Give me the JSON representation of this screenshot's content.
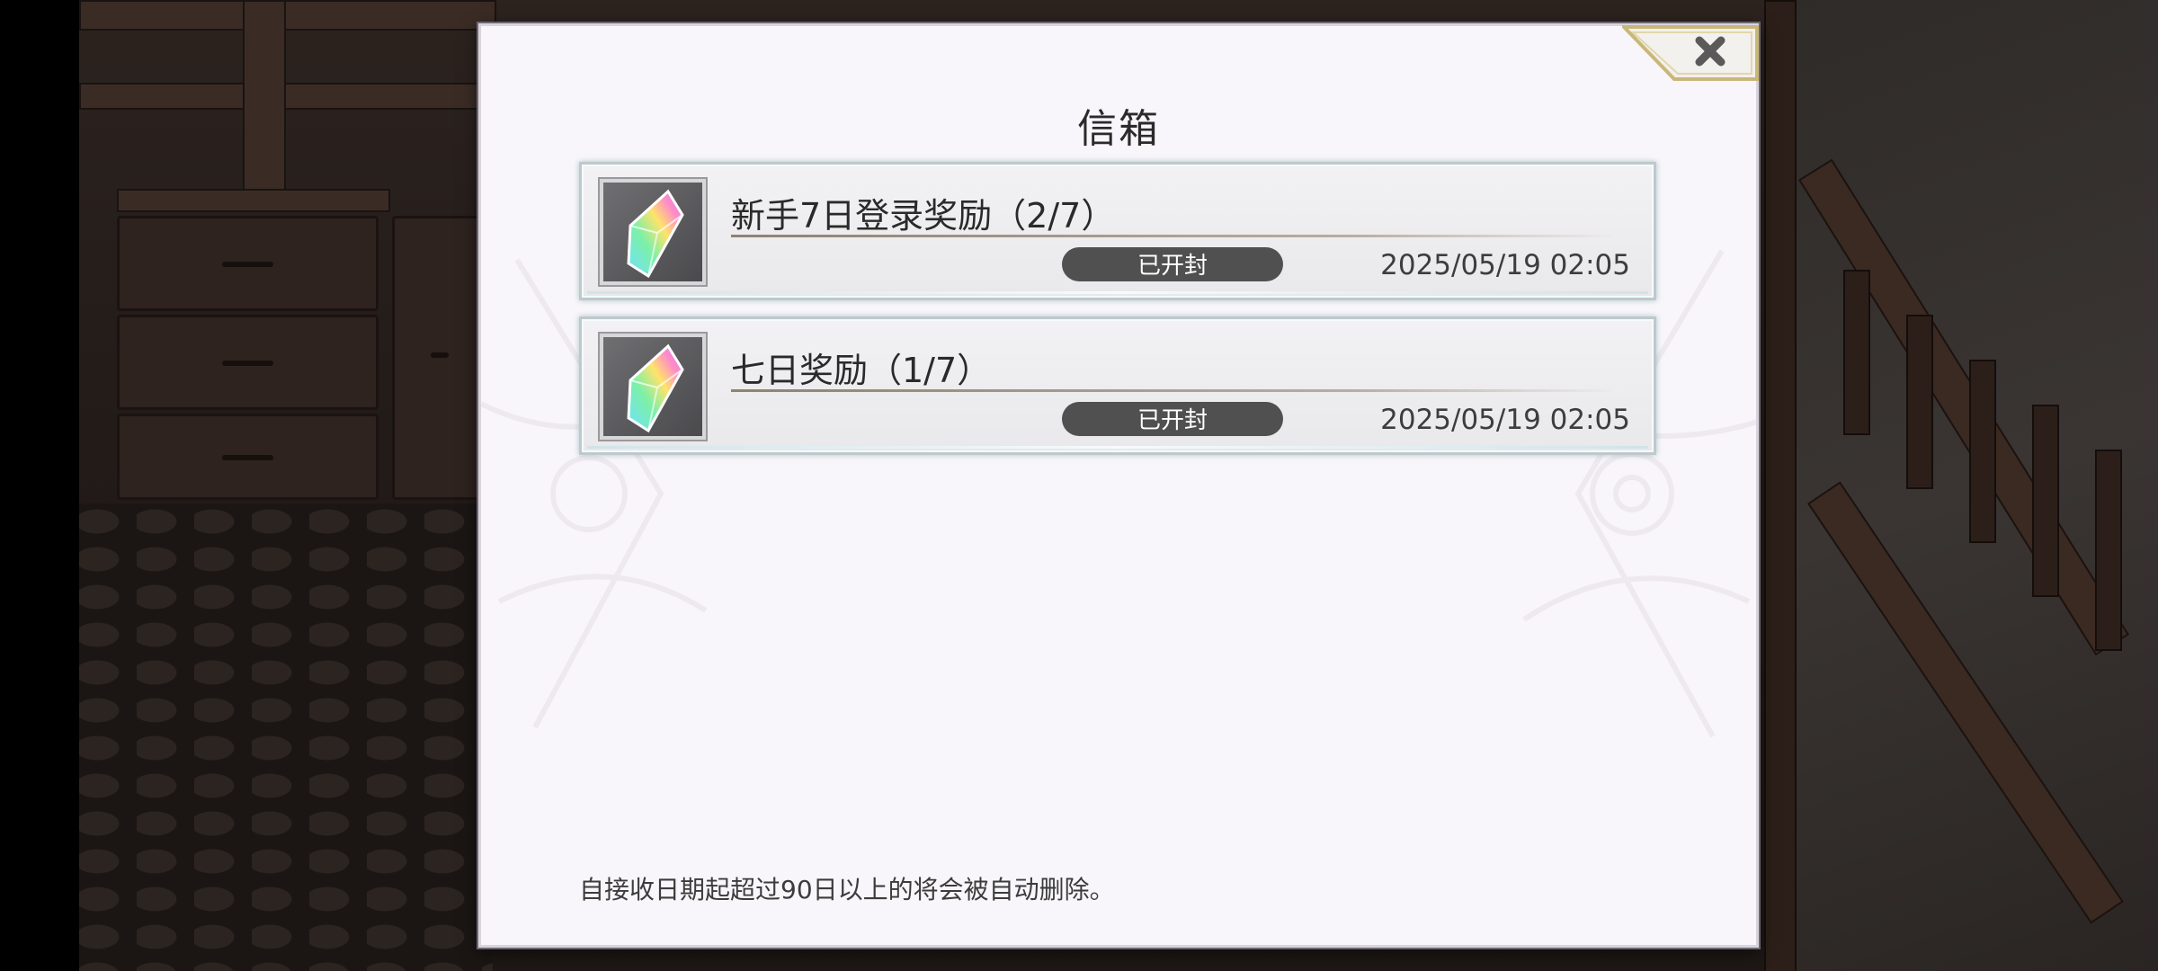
{
  "dialog": {
    "title": "信箱",
    "close_icon": "close-x-icon"
  },
  "mails": [
    {
      "title": "新手7日登录奖励（2/7）",
      "status": "已开封",
      "timestamp": "2025/05/19 02:05",
      "icon": "rainbow-crystal-icon"
    },
    {
      "title": "七日奖励（1/7）",
      "status": "已开封",
      "timestamp": "2025/05/19 02:05",
      "icon": "rainbow-crystal-icon"
    }
  ],
  "footer": {
    "note": "自接收日期起超过90日以上的将会被自动删除。"
  },
  "colors": {
    "dialog_bg": "#f8f6fa",
    "status_badge": "#505050",
    "close_frame_gold": "#c9b77a",
    "item_glow": "#bfc9cc"
  }
}
